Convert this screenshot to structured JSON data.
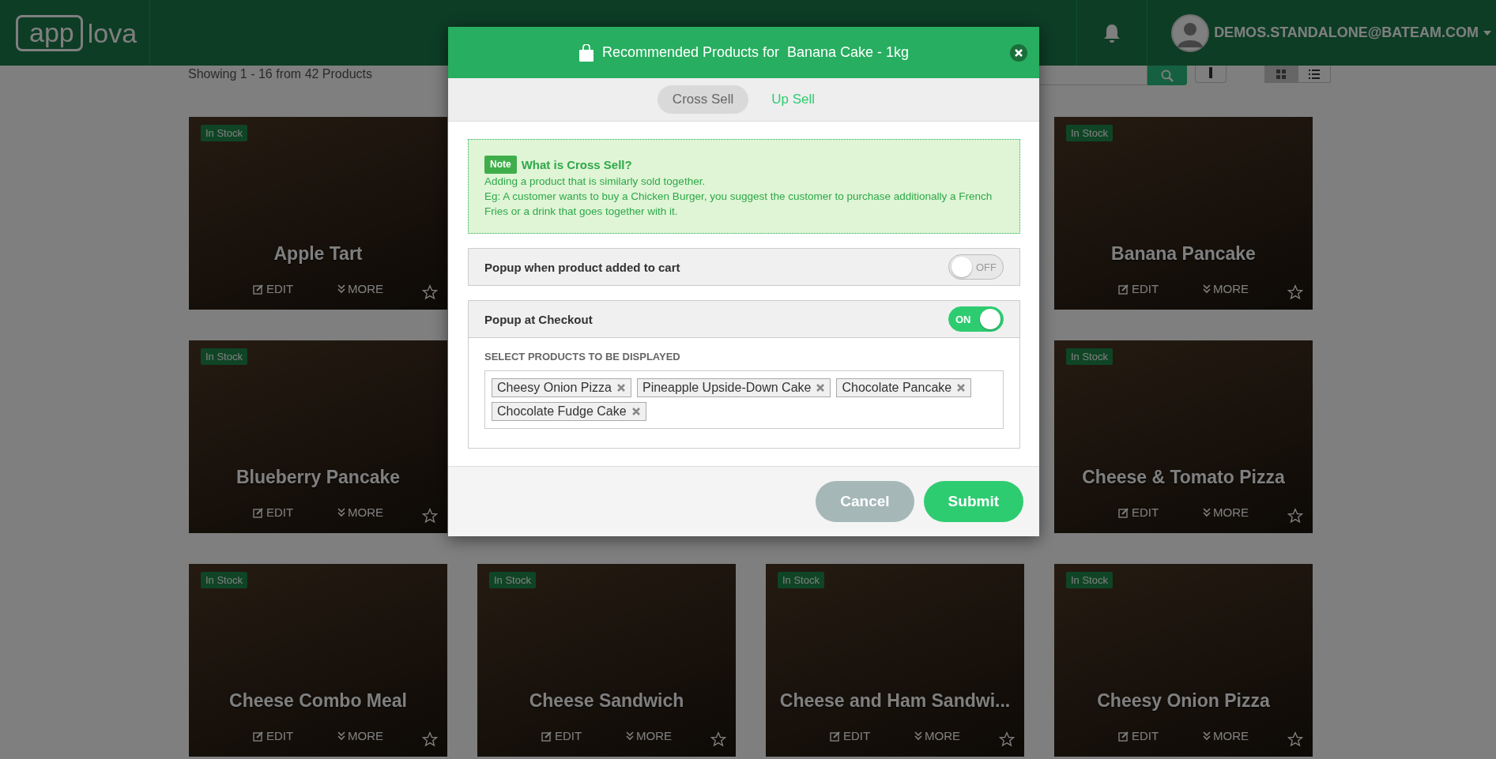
{
  "header": {
    "logo": {
      "boxed": "app",
      "plain": "lova"
    },
    "user_email": "DEMOS.STANDALONE@BATEAM.COM"
  },
  "toolbar": {
    "summary": "Showing 1 - 16 from 42 Products",
    "view_modes": [
      {
        "kind": "grid",
        "selected": true
      },
      {
        "kind": "list",
        "selected": false
      }
    ]
  },
  "product_rows": [
    [
      {
        "name": "Apple Tart",
        "badge": "In Stock",
        "edit": "EDIT",
        "more": "MORE"
      },
      {
        "name": "Banana Pancake",
        "badge": "In Stock",
        "edit": "EDIT",
        "more": "MORE"
      }
    ],
    [
      {
        "name": "Blueberry Pancake",
        "badge": "In Stock",
        "edit": "EDIT",
        "more": "MORE"
      },
      {
        "name": "Cheese & Tomato Pizza",
        "badge": "In Stock",
        "edit": "EDIT",
        "more": "MORE"
      }
    ],
    [
      {
        "name": "Cheese Combo Meal",
        "badge": "In Stock",
        "edit": "EDIT",
        "more": "MORE"
      },
      {
        "name": "Cheese Sandwich",
        "badge": "In Stock",
        "edit": "EDIT",
        "more": "MORE"
      },
      {
        "name": "Cheese and Ham Sandwi...",
        "badge": "In Stock",
        "edit": "EDIT",
        "more": "MORE"
      },
      {
        "name": "Cheesy Onion Pizza",
        "badge": "In Stock",
        "edit": "EDIT",
        "more": "MORE"
      }
    ]
  ],
  "modal": {
    "title": "Recommended Products for  Banana Cake - 1kg",
    "tabs": [
      {
        "label": "Cross Sell",
        "selected": true
      },
      {
        "label": "Up Sell",
        "selected": false
      }
    ],
    "note": {
      "badge": "Note",
      "heading": "What is Cross Sell?",
      "lines": [
        "Adding a product that is similarly sold together.",
        "Eg: A customer wants to buy a Chicken Burger, you suggest the customer to purchase additionally a French Fries or a drink that goes together with it."
      ]
    },
    "settings": [
      {
        "label": "Popup when product added to cart",
        "on": false,
        "toggle_text": "OFF"
      },
      {
        "label": "Popup at Checkout",
        "on": true,
        "toggle_text": "ON"
      }
    ],
    "select_label": "SELECT PRODUCTS TO BE DISPLAYED",
    "selected_products": [
      "Cheesy Onion Pizza",
      "Pineapple Upside-Down Cake",
      "Chocolate Pancake",
      "Chocolate Fudge Cake"
    ],
    "buttons": {
      "cancel": "Cancel",
      "submit": "Submit"
    }
  }
}
